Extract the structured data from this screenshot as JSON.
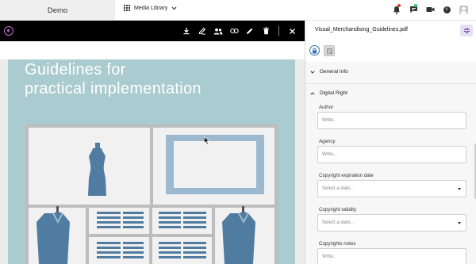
{
  "app": {
    "brand": "Demo",
    "library_menu": "Media Library",
    "top_icons": [
      "notifications-icon",
      "chat-icon",
      "video-call-icon",
      "info-icon",
      "user-avatar"
    ],
    "notification_dot_color": "#e53935",
    "chat_dot_color": "#2ecc71"
  },
  "viewer": {
    "toolbar_icons": [
      "download-icon",
      "annotate-icon",
      "share-users-icon",
      "link-icon",
      "edit-icon",
      "delete-icon",
      "close-icon"
    ],
    "document_title": "Guidelines for\npractical implementation",
    "page_color": "#aacbd0"
  },
  "panel": {
    "file_name": "Visual_Merchandising_Guidelines.pdf",
    "sections": {
      "general_info": "General Info",
      "digital_right": "Digital Right"
    },
    "fields": {
      "author": {
        "label": "Author",
        "placeholder": "Write..."
      },
      "agency": {
        "label": "Agency",
        "placeholder": "Write..."
      },
      "copyright_expiration": {
        "label": "Copyright expiration date",
        "placeholder": "Select a date..."
      },
      "copyright_validity": {
        "label": "Copyright validity",
        "placeholder": "Select a date..."
      },
      "copyrights_notes": {
        "label": "Copyrights notes",
        "placeholder": "Write..."
      }
    },
    "accent_color": "#e8dff3"
  }
}
